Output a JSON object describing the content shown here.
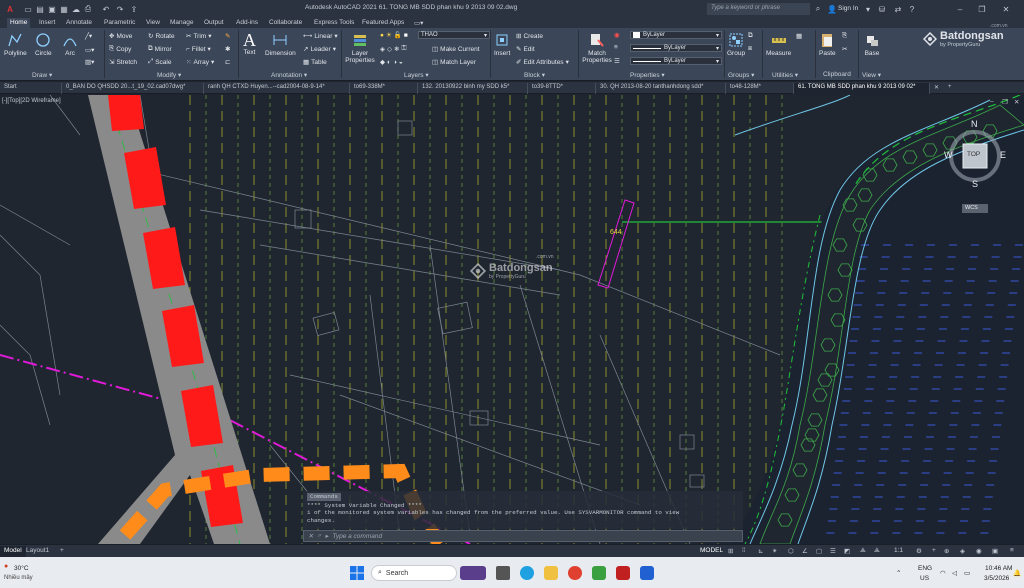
{
  "app": {
    "title": "Autodesk AutoCAD 2021    61. TONG MB SDD phan khu 9  2013 09 02.dwg",
    "search_placeholder": "Type a keyword or phrase",
    "sign_in": "Sign In"
  },
  "ribbon_tabs": [
    "Home",
    "Insert",
    "Annotate",
    "Parametric",
    "View",
    "Manage",
    "Output",
    "Add-ins",
    "Collaborate",
    "Express Tools",
    "Featured Apps"
  ],
  "ribbon_tab_active": "Home",
  "draw": {
    "polyline": "Polyline",
    "circle": "Circle",
    "arc": "Arc",
    "panel": "Draw ▾"
  },
  "modify": {
    "move": "Move",
    "rotate": "Rotate",
    "trim": "Trim",
    "copy": "Copy",
    "mirror": "Mirror",
    "fillet": "Fillet",
    "stretch": "Stretch",
    "scale": "Scale",
    "array": "Array",
    "panel": "Modify ▾"
  },
  "annotation": {
    "text": "Text",
    "dimension": "Dimension",
    "linear": "Linear",
    "leader": "Leader",
    "table": "Table",
    "panel": "Annotation ▾"
  },
  "layers": {
    "layer_properties": "Layer Properties",
    "current_layer": "THAO",
    "make_current": "Make Current",
    "match_layer": "Match Layer",
    "panel": "Layers ▾"
  },
  "block": {
    "insert": "Insert",
    "create": "Create",
    "edit": "Edit",
    "edit_attributes": "Edit Attributes",
    "panel": "Block ▾"
  },
  "properties": {
    "match": "Match Properties",
    "color": "ByLayer",
    "linetype": "ByLayer",
    "lineweight": "ByLayer",
    "panel": "Properties ▾"
  },
  "groups": {
    "group": "Group",
    "panel": "Groups ▾"
  },
  "utilities": {
    "measure": "Measure",
    "panel": "Utilities ▾"
  },
  "clipboard": {
    "paste": "Paste",
    "panel": "Clipboard"
  },
  "view": {
    "base": "Base",
    "panel": "View ▾"
  },
  "doc_tabs": [
    "Start",
    "0_BAN DO QHSDD 20...t_19_02.cad07dwg*",
    "ranh QH CTXD Huyen...--cad2004-08-9-14*",
    "to69-338M*",
    "132. 20130922 binh my SDD k5*",
    "to39-8TTD*",
    "30. QH 2013-08-20 tanthanhdong sdd*",
    "to48-128M*",
    "61. TONG MB SDD phan khu 9  2013 09 02*"
  ],
  "doc_tab_active": 8,
  "viewport_label": "[-][Top][2D Wireframe]",
  "viewcube": {
    "n": "N",
    "s": "S",
    "e": "E",
    "w": "W",
    "top": "TOP",
    "wcs": "WCS"
  },
  "canvas_label": "644",
  "watermark": {
    "brand": "Batdongsan",
    "sub": "by PropertyGuru",
    "com": ".com.vn"
  },
  "commands": {
    "header": "Commands",
    "line1": "**** System Variable Changed ****",
    "line2": "1 of the monitored system variables has changed from the preferred value. Use SYSVARMONITOR command to view",
    "line3": "changes.",
    "prompt": "Type a command"
  },
  "status": {
    "model": "Model",
    "layout": "Layout1",
    "model_btn": "MODEL",
    "scale": "1:1"
  },
  "taskbar": {
    "weather_temp": "30°C",
    "weather_desc": "Nhiều mây",
    "search": "Search",
    "lang1": "ENG",
    "lang2": "US",
    "time": "10:46 AM",
    "date": "3/5/2026"
  },
  "colors": {
    "road_red": "#ff1a1a",
    "road_gray": "#8a8a8a",
    "orange_dash": "#ff8c1a",
    "magenta": "#e01ad8",
    "green_line": "#1ec23a",
    "yellow_line": "#b8b82a",
    "cyan_line": "#6fc6e6",
    "blue_dash": "#3b5ad6",
    "hex_green": "#3ea84a"
  }
}
